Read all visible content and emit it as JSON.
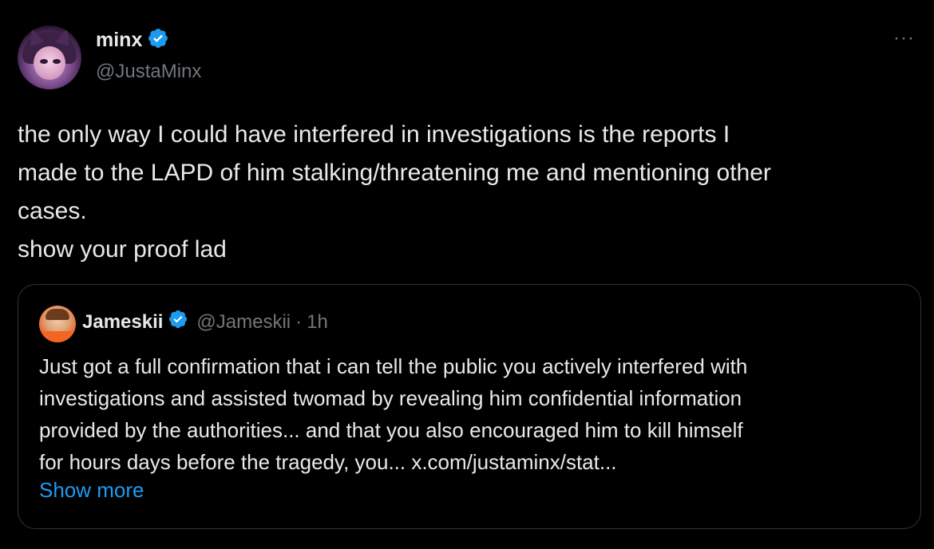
{
  "post": {
    "author_name": "minx",
    "author_handle": "@JustaMinx",
    "more_label": "···",
    "text_lines": [
      "the only way I could have interfered in investigations is the reports I",
      "made to the LAPD of him stalking/threatening me and mentioning other",
      "cases.",
      "show your proof lad"
    ]
  },
  "quote": {
    "author_name": "Jameskii",
    "author_handle": "@Jameskii",
    "separator": "·",
    "time": "1h",
    "text_lines": [
      "Just got a full confirmation that i can tell the public you actively interfered with",
      "investigations and assisted twomad by revealing him confidential information",
      "provided by the authorities... and that you also encouraged him to kill himself",
      "for hours days before the tragedy, you... x.com/justaminx/stat..."
    ],
    "show_more_label": "Show more"
  },
  "colors": {
    "background": "#000000",
    "text": "#e7e9ea",
    "muted": "#71767b",
    "accent": "#1d9bf0",
    "border": "#2f3336"
  },
  "icons": {
    "verified": "verified-badge-icon",
    "more": "more-horizontal-icon"
  }
}
